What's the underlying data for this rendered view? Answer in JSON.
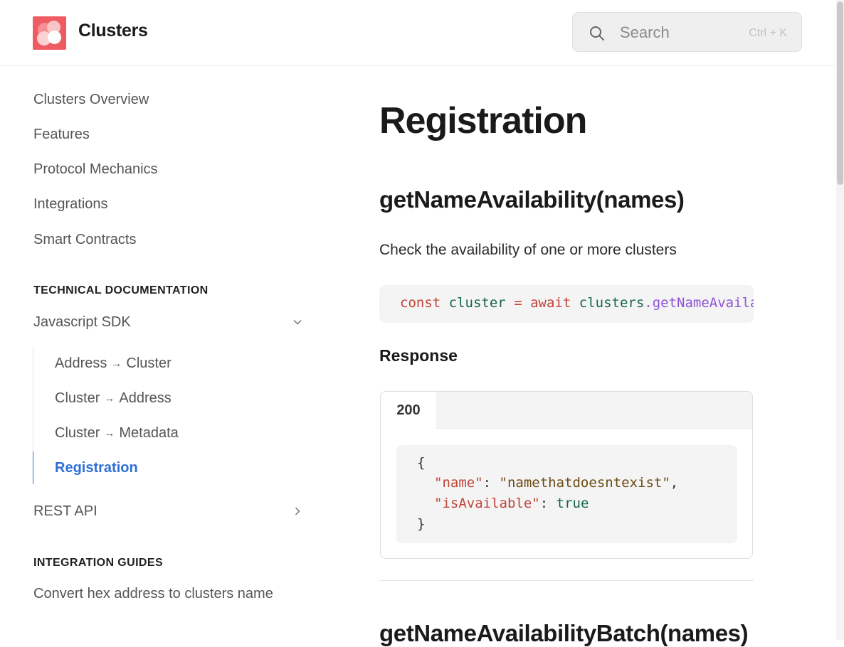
{
  "header": {
    "site_title": "Clusters",
    "search_placeholder": "Search",
    "search_shortcut": "Ctrl + K"
  },
  "sidebar": {
    "items": [
      {
        "label": "Clusters Overview"
      },
      {
        "label": "Features"
      },
      {
        "label": "Protocol Mechanics"
      },
      {
        "label": "Integrations"
      },
      {
        "label": "Smart Contracts"
      }
    ],
    "section_technical": "TECHNICAL DOCUMENTATION",
    "js_sdk": {
      "label": "Javascript SDK",
      "expanded": true,
      "children": [
        {
          "from": "Address",
          "arrow": "→",
          "to": "Cluster"
        },
        {
          "from": "Cluster",
          "arrow": "→",
          "to": "Address"
        },
        {
          "from": "Cluster",
          "arrow": "→",
          "to": "Metadata"
        },
        {
          "label": "Registration",
          "active": true
        }
      ]
    },
    "rest_api": {
      "label": "REST API",
      "expanded": false
    },
    "section_guides": "INTEGRATION GUIDES",
    "guides": [
      {
        "label": "Convert hex address to clusters name"
      }
    ]
  },
  "main": {
    "title": "Registration",
    "method1": {
      "heading": "getNameAvailability(names)",
      "description": "Check the availability of one or more clusters",
      "code": {
        "kw_const": "const",
        "var": "cluster",
        "eq": "=",
        "kw_await": "await",
        "obj": "clusters",
        "dot": ".",
        "fn": "getNameAvailability"
      },
      "response_heading": "Response",
      "response_tab": "200",
      "response_json": {
        "open": "{",
        "name_key": "\"name\"",
        "name_value": "\"namethatdoesntexist\"",
        "avail_key": "\"isAvailable\"",
        "avail_value": "true",
        "colon": ":",
        "comma": ",",
        "close": "}"
      }
    },
    "method2": {
      "heading": "getNameAvailabilityBatch(names)"
    }
  },
  "colors": {
    "accent": "#2f6fd6",
    "logo": "#ef5b62"
  },
  "icons": [
    "clusters-logo-icon",
    "search-icon",
    "chevron-down-icon",
    "chevron-right-icon"
  ]
}
